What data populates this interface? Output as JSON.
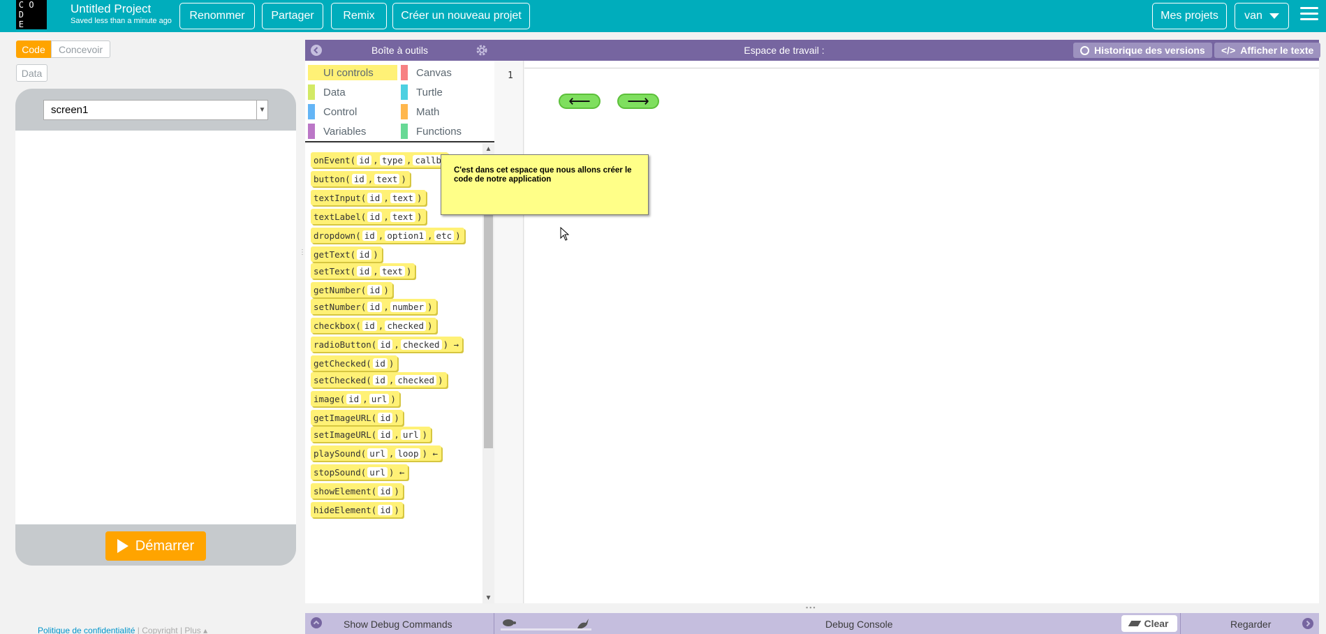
{
  "header": {
    "logo_letters": [
      "C",
      "O",
      "",
      "D",
      "",
      "",
      "E",
      "",
      ""
    ],
    "project_title": "Untitled Project",
    "save_status": "Saved less than a minute ago",
    "rename_label": "Renommer",
    "share_label": "Partager",
    "remix_label": "Remix",
    "new_project_label": "Créer un nouveau projet",
    "my_projects_label": "Mes projets",
    "user_label": "van",
    "accent_color": "#00adbc"
  },
  "mode_toggle": {
    "code_label": "Code",
    "design_label": "Concevoir",
    "data_label": "Data"
  },
  "app_preview": {
    "screen_selected": "screen1",
    "run_label": "Démarrer"
  },
  "footer": {
    "privacy_label": "Politique de confidentialité",
    "separator": "|",
    "copyright_label": "Copyright",
    "more_label": "Plus ▴"
  },
  "toolbox": {
    "title": "Boîte à outils",
    "categories": [
      {
        "label": "UI controls",
        "color": "#fff176"
      },
      {
        "label": "Canvas",
        "color": "#f78183"
      },
      {
        "label": "Data",
        "color": "#d3e965"
      },
      {
        "label": "Turtle",
        "color": "#4dd0e1"
      },
      {
        "label": "Control",
        "color": "#64b5f6"
      },
      {
        "label": "Math",
        "color": "#ffb74d"
      },
      {
        "label": "Variables",
        "color": "#bb77c7"
      },
      {
        "label": "Functions",
        "color": "#68d995"
      }
    ],
    "blocks": [
      {
        "fn": "onEvent(",
        "args": [
          "id",
          "type",
          "callb"
        ],
        "tail": ""
      },
      {
        "fn": "button(",
        "args": [
          "id",
          "text"
        ],
        "tail": ")"
      },
      {
        "fn": "textInput(",
        "args": [
          "id",
          "text"
        ],
        "tail": ")"
      },
      {
        "fn": "textLabel(",
        "args": [
          "id",
          "text"
        ],
        "tail": ")"
      },
      {
        "fn": "dropdown(",
        "args": [
          "id",
          "option1",
          "etc"
        ],
        "tail": ")"
      },
      {
        "fn": "getText(",
        "args": [
          "id"
        ],
        "tail": ")"
      },
      {
        "fn": "setText(",
        "args": [
          "id",
          "text"
        ],
        "tail": ")"
      },
      {
        "fn": "getNumber(",
        "args": [
          "id"
        ],
        "tail": ")"
      },
      {
        "fn": "setNumber(",
        "args": [
          "id",
          "number"
        ],
        "tail": ")"
      },
      {
        "fn": "checkbox(",
        "args": [
          "id",
          "checked"
        ],
        "tail": ")"
      },
      {
        "fn": "radioButton(",
        "args": [
          "id",
          "checked"
        ],
        "tail": ") →"
      },
      {
        "fn": "getChecked(",
        "args": [
          "id"
        ],
        "tail": ")"
      },
      {
        "fn": "setChecked(",
        "args": [
          "id",
          "checked"
        ],
        "tail": ")"
      },
      {
        "fn": "image(",
        "args": [
          "id",
          "url"
        ],
        "tail": ")"
      },
      {
        "fn": "getImageURL(",
        "args": [
          "id"
        ],
        "tail": ")"
      },
      {
        "fn": "setImageURL(",
        "args": [
          "id",
          "url"
        ],
        "tail": ")"
      },
      {
        "fn": "playSound(",
        "args": [
          "url",
          "loop"
        ],
        "tail": ") ←"
      },
      {
        "fn": "stopSound(",
        "args": [
          "url"
        ],
        "tail": ") ←"
      },
      {
        "fn": "showElement(",
        "args": [
          "id"
        ],
        "tail": ")"
      },
      {
        "fn": "hideElement(",
        "args": [
          "id"
        ],
        "tail": ")"
      }
    ]
  },
  "workspace": {
    "title": "Espace de travail :",
    "version_history_label": "Historique des versions",
    "show_text_label": "Afficher le texte",
    "line_number": "1",
    "left_arrow_glyph": "⟵",
    "right_arrow_glyph": "⟶",
    "tooltip_text": "C'est dans cet espace que nous allons créer le code de notre application"
  },
  "debug": {
    "show_commands_label": "Show Debug Commands",
    "console_label": "Debug Console",
    "clear_label": "Clear",
    "watch_label": "Regarder"
  }
}
